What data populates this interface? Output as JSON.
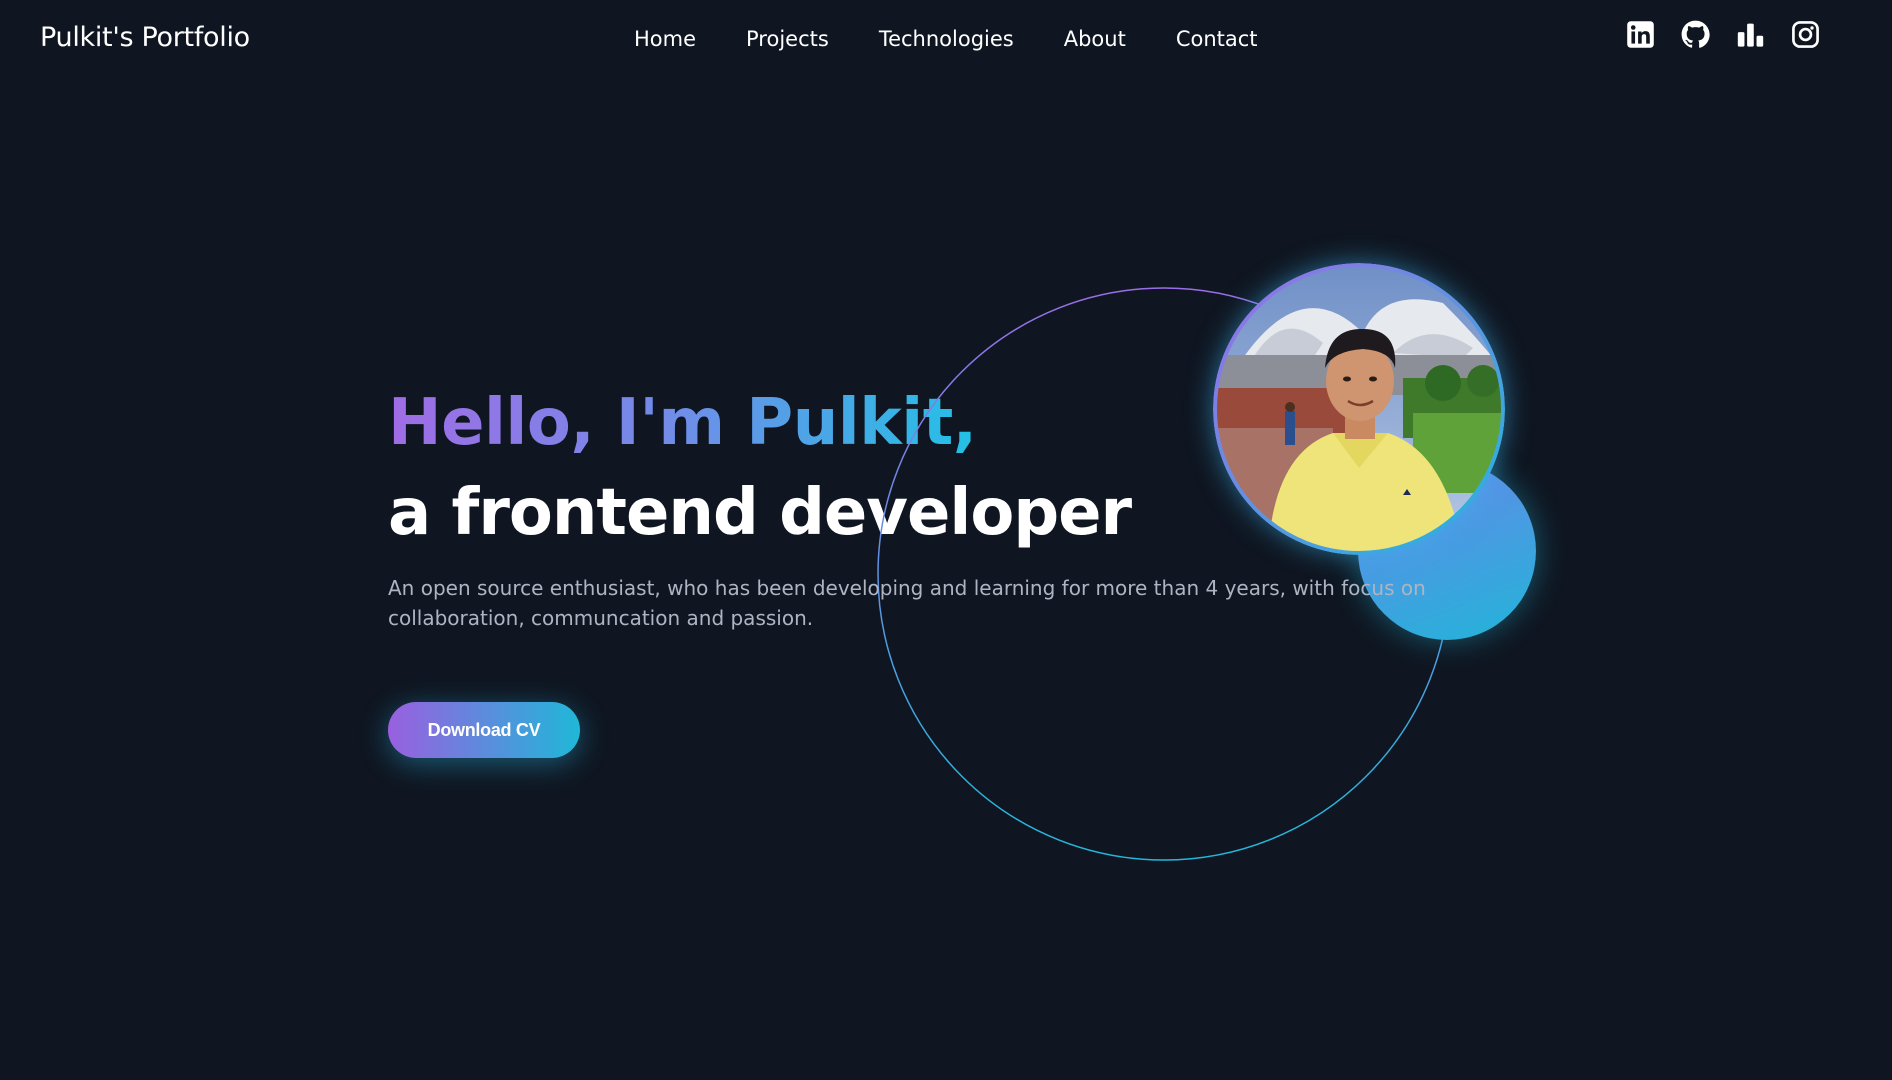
{
  "nav": {
    "brand": "Pulkit's Portfolio",
    "links": [
      {
        "label": "Home"
      },
      {
        "label": "Projects"
      },
      {
        "label": "Technologies"
      },
      {
        "label": "About"
      },
      {
        "label": "Contact"
      }
    ],
    "socials": [
      {
        "icon": "linkedin-icon"
      },
      {
        "icon": "github-icon"
      },
      {
        "icon": "bar-chart-icon"
      },
      {
        "icon": "instagram-icon"
      }
    ]
  },
  "hero": {
    "greeting": "Hello, I'm Pulkit,",
    "role": "a frontend developer",
    "description": "An open source enthusiast, who has been developing and learning for more than 4 years, with focus on collaboration, communcation and passion.",
    "cta_label": "Download CV"
  },
  "colors": {
    "background": "#0f1621",
    "gradient_start": "#a06ce6",
    "gradient_end": "#22c1e6",
    "description_text": "#aeb4c2"
  }
}
